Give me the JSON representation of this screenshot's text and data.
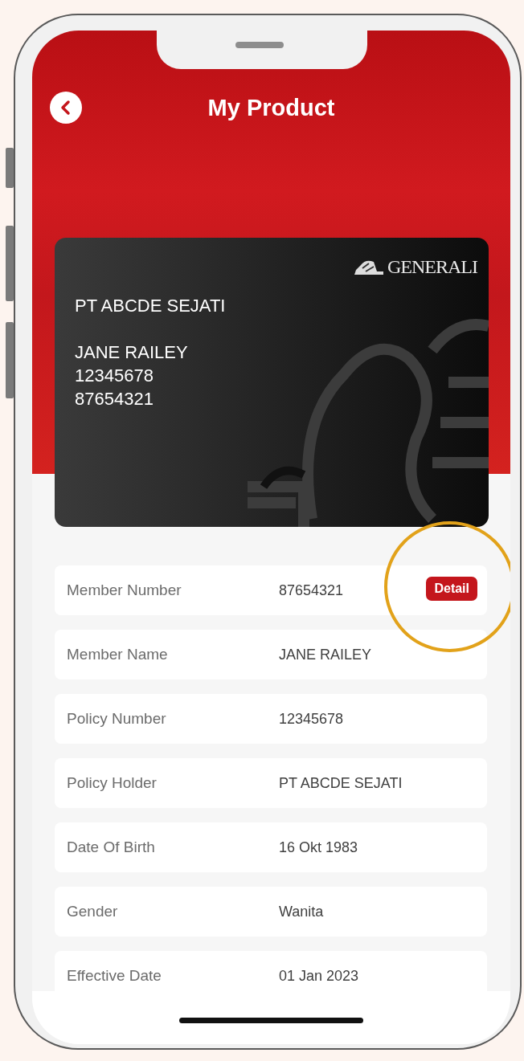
{
  "header": {
    "title": "My Product"
  },
  "card": {
    "logo_text": "GENERALI",
    "company": "PT ABCDE SEJATI",
    "member_name": "JANE RAILEY",
    "policy_number": "12345678",
    "member_number": "87654321"
  },
  "details": [
    {
      "label": "Member Number",
      "value": "87654321",
      "action": "Detail",
      "highlighted": true
    },
    {
      "label": "Member Name",
      "value": "JANE RAILEY"
    },
    {
      "label": "Policy Number",
      "value": "12345678"
    },
    {
      "label": "Policy Holder",
      "value": "PT ABCDE SEJATI"
    },
    {
      "label": "Date Of Birth",
      "value": "16 Okt 1983"
    },
    {
      "label": "Gender",
      "value": "Wanita"
    },
    {
      "label": "Effective Date",
      "value": "01 Jan 2023"
    }
  ]
}
